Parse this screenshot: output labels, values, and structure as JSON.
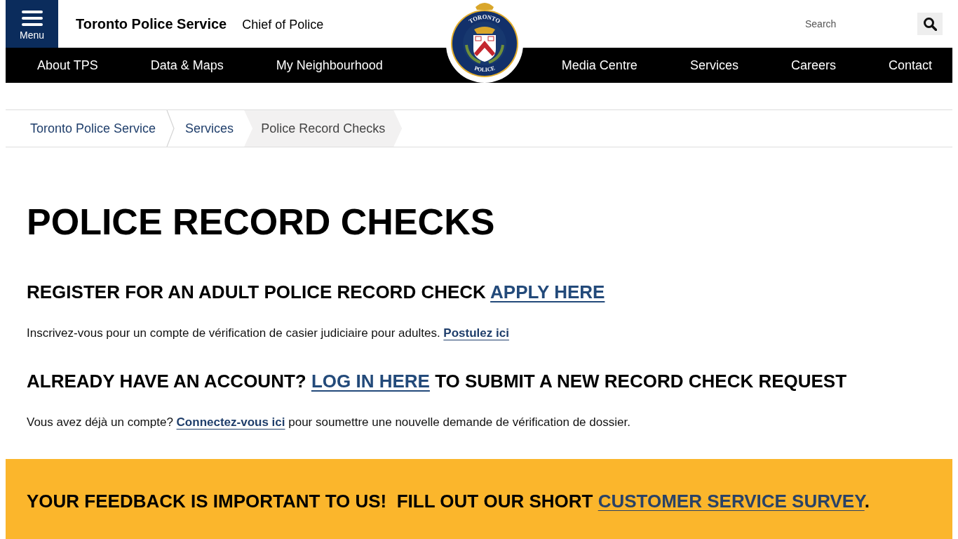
{
  "header": {
    "menu_button": "Menu",
    "site_title": "Toronto Police Service",
    "chief_link": "Chief of Police",
    "logo": {
      "top_text": "TORONTO",
      "bottom_text": "POLICE"
    },
    "search": {
      "placeholder": "Search"
    }
  },
  "nav": {
    "left": [
      "About TPS",
      "Data & Maps",
      "My Neighbourhood"
    ],
    "right": [
      "Media Centre",
      "Services",
      "Careers",
      "Contact"
    ]
  },
  "breadcrumb": [
    {
      "label": "Toronto Police Service",
      "selected": false
    },
    {
      "label": "Services",
      "selected": false
    },
    {
      "label": "Police Record Checks",
      "selected": true
    }
  ],
  "page_title": "POLICE RECORD CHECKS",
  "sections": [
    {
      "heading": [
        {
          "kind": "text",
          "text": "REGISTER FOR AN ADULT POLICE RECORD CHECK "
        },
        {
          "kind": "link",
          "text": "APPLY HERE"
        }
      ],
      "paragraph": [
        {
          "kind": "text",
          "text": "Inscrivez-vous pour un compte de vérification de casier judiciaire pour adultes. "
        },
        {
          "kind": "link",
          "text": "Postulez ici"
        }
      ]
    },
    {
      "heading": [
        {
          "kind": "text",
          "text": "ALREADY HAVE AN ACCOUNT? "
        },
        {
          "kind": "link",
          "text": "LOG IN HERE"
        },
        {
          "kind": "text",
          "text": " TO SUBMIT A NEW RECORD CHECK REQUEST"
        }
      ],
      "paragraph": [
        {
          "kind": "text",
          "text": "Vous avez déjà un compte? "
        },
        {
          "kind": "link",
          "text": "Connectez-vous ici"
        },
        {
          "kind": "text",
          "text": " pour soumettre une nouvelle demande de vérification de dossier."
        }
      ]
    }
  ],
  "feedback_banner": [
    {
      "kind": "text",
      "text": "YOUR FEEDBACK IS IMPORTANT TO US!  FILL OUT OUR SHORT "
    },
    {
      "kind": "link",
      "text": "CUSTOMER SERVICE SURVEY"
    },
    {
      "kind": "text",
      "text": "."
    }
  ]
}
